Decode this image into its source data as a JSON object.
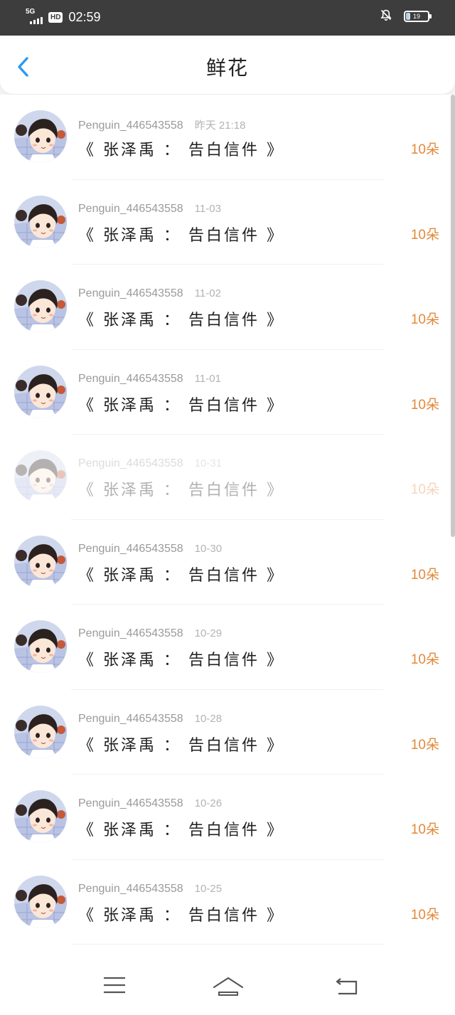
{
  "status_bar": {
    "network": "5G",
    "hd": "HD",
    "time": "02:59",
    "battery_level": "19"
  },
  "header": {
    "back_icon": "chevron-left-icon",
    "title": "鲜花"
  },
  "colors": {
    "accent_blue": "#2b9af3",
    "flower_orange": "#e3893a",
    "status_bar_bg": "#3d3d3d"
  },
  "list": {
    "items": [
      {
        "username": "Penguin_446543558",
        "time": "昨天 21:18",
        "title": "《 张泽禹 ： 告白信件 》",
        "count": "10朵"
      },
      {
        "username": "Penguin_446543558",
        "time": "11-03",
        "title": "《 张泽禹 ： 告白信件 》",
        "count": "10朵"
      },
      {
        "username": "Penguin_446543558",
        "time": "11-02",
        "title": "《 张泽禹 ： 告白信件 》",
        "count": "10朵"
      },
      {
        "username": "Penguin_446543558",
        "time": "11-01",
        "title": "《 张泽禹 ： 告白信件 》",
        "count": "10朵"
      },
      {
        "username": "Penguin_446543558",
        "time": "10-31",
        "title": "《 张泽禹 ： 告白信件 》",
        "count": "10朵"
      },
      {
        "username": "Penguin_446543558",
        "time": "10-30",
        "title": "《 张泽禹 ： 告白信件 》",
        "count": "10朵"
      },
      {
        "username": "Penguin_446543558",
        "time": "10-29",
        "title": "《 张泽禹 ： 告白信件 》",
        "count": "10朵"
      },
      {
        "username": "Penguin_446543558",
        "time": "10-28",
        "title": "《 张泽禹 ： 告白信件 》",
        "count": "10朵"
      },
      {
        "username": "Penguin_446543558",
        "time": "10-26",
        "title": "《 张泽禹 ： 告白信件 》",
        "count": "10朵"
      },
      {
        "username": "Penguin_446543558",
        "time": "10-25",
        "title": "《 张泽禹 ： 告白信件 》",
        "count": "10朵"
      }
    ]
  },
  "bottom_nav": {
    "menu_icon": "menu-icon",
    "home_icon": "home-icon",
    "back_icon": "back-arrow-icon"
  }
}
